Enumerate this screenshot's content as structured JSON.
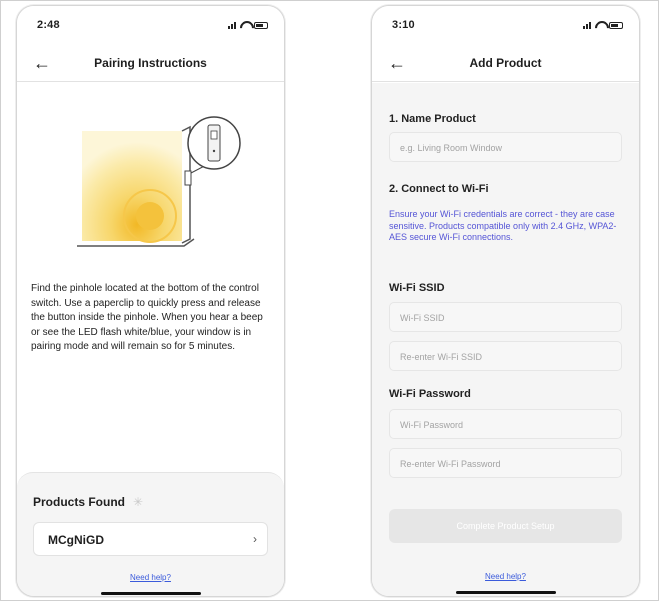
{
  "left_screen": {
    "status_time": "2:48",
    "nav": {
      "back_icon": "arrow-left-icon",
      "title": "Pairing Instructions"
    },
    "illustration": "window-control-switch-illustration",
    "instructions": "Find the pinhole located at the bottom of the control switch. Use a paperclip to quickly press and release the button inside the pinhole. When you hear a beep or see the LED flash white/blue, your window is in pairing mode and will remain so for 5 minutes.",
    "products_found": {
      "title": "Products Found",
      "spinner_icon": "loading-spinner-icon",
      "devices": [
        {
          "name": "MCgNiGD",
          "chevron": "›"
        }
      ]
    },
    "help_link": "Need help?"
  },
  "right_screen": {
    "status_time": "3:10",
    "nav": {
      "back_icon": "arrow-left-icon",
      "title": "Add Product"
    },
    "name_section": {
      "title": "1. Name Product",
      "placeholder": "e.g. Living Room Window"
    },
    "wifi_section": {
      "title": "2. Connect to Wi-Fi",
      "note": "Ensure your Wi-Fi credentials are correct - they are case sensitive. Products compatible only with 2.4 GHz, WPA2-AES secure Wi-Fi connections."
    },
    "ssid_section": {
      "title": "Wi-Fi SSID",
      "ssid_placeholder": "Wi-Fi SSID",
      "ssid_confirm_placeholder": "Re-enter Wi-Fi SSID"
    },
    "password_section": {
      "title": "Wi-Fi Password",
      "password_placeholder": "Wi-Fi Password",
      "password_confirm_placeholder": "Re-enter Wi-Fi Password"
    },
    "complete_button": "Complete Product Setup",
    "help_link": "Need help?"
  },
  "colors": {
    "accent_link": "#3b5bdb",
    "note_text": "#5555d6",
    "disabled_button": "#e6e6e6",
    "illustration_glow": "#f7d66a"
  }
}
